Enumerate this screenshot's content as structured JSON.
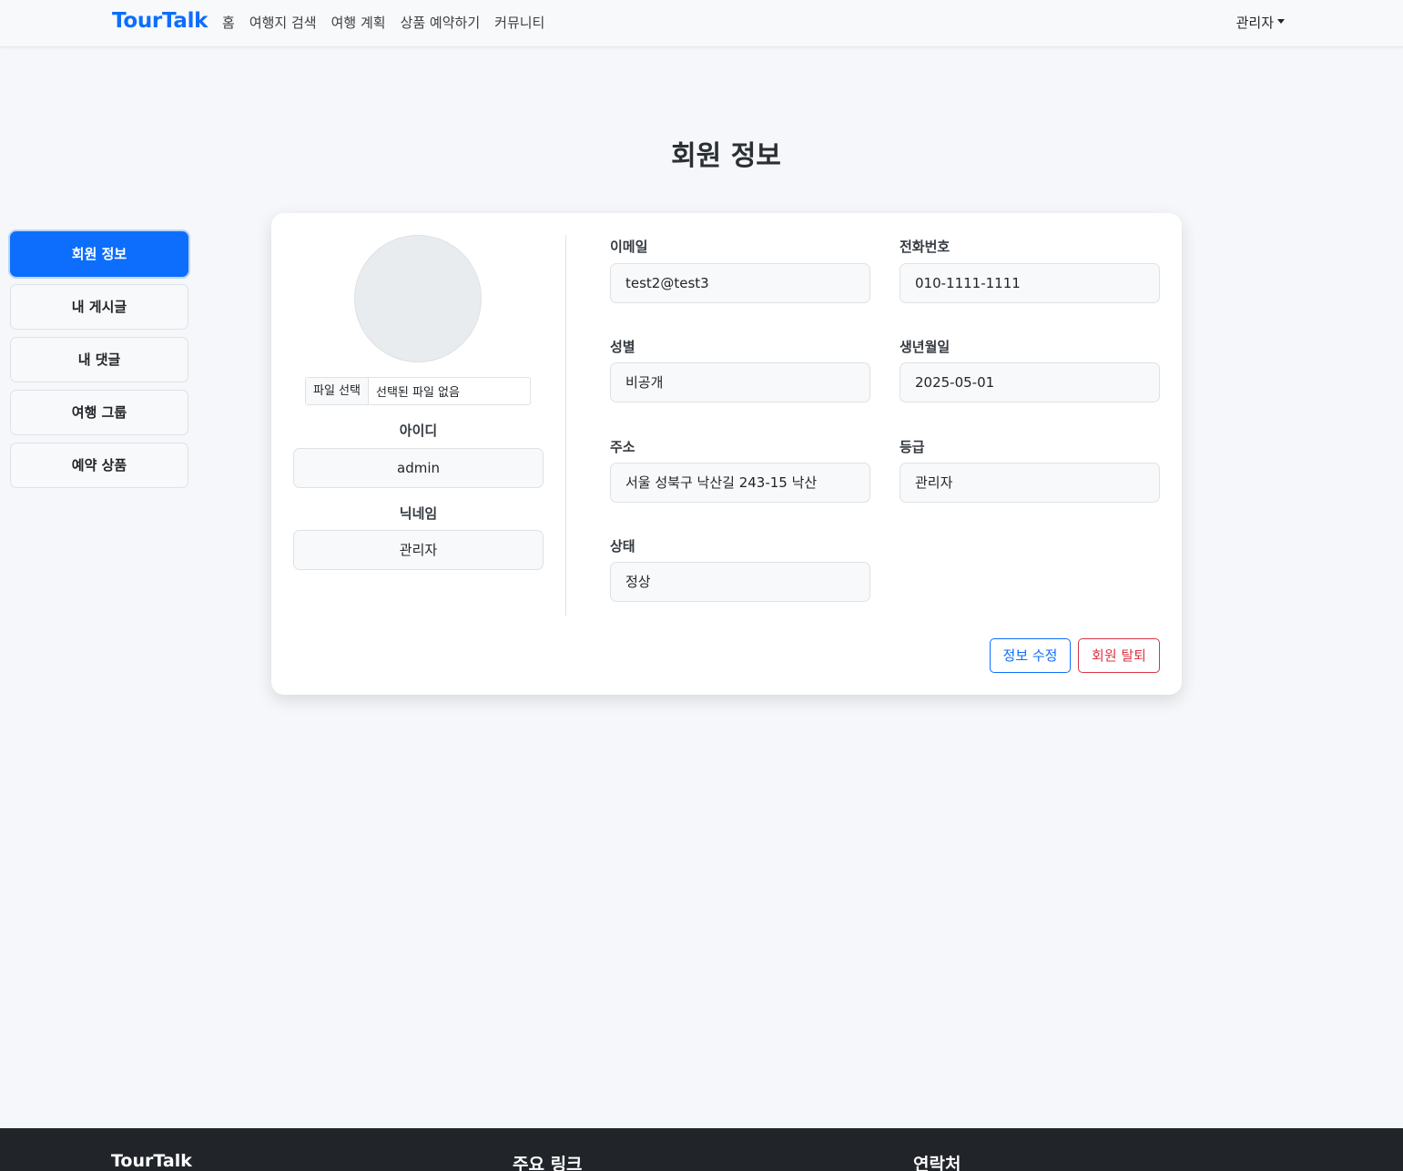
{
  "navbar": {
    "brand": "TourTalk",
    "links": [
      "홈",
      "여행지 검색",
      "여행 계획",
      "상품 예약하기",
      "커뮤니티"
    ],
    "user": "관리자"
  },
  "page": {
    "title": "회원 정보"
  },
  "sidebar": {
    "items": [
      "회원 정보",
      "내 게시글",
      "내 댓글",
      "여행 그룹",
      "예약 상품"
    ],
    "active_index": 0
  },
  "profile": {
    "file_button": "파일 선택",
    "file_status": "선택된 파일 없음",
    "id_label": "아이디",
    "id_value": "admin",
    "nickname_label": "닉네임",
    "nickname_value": "관리자"
  },
  "fields": {
    "email": {
      "label": "이메일",
      "value": "test2@test3"
    },
    "phone": {
      "label": "전화번호",
      "value": "010-1111-1111"
    },
    "gender": {
      "label": "성별",
      "value": "비공개"
    },
    "birth": {
      "label": "생년월일",
      "value": "2025-05-01"
    },
    "address": {
      "label": "주소",
      "value": "서울 성북구 낙산길 243-15 낙산"
    },
    "grade": {
      "label": "등급",
      "value": "관리자"
    },
    "status": {
      "label": "상태",
      "value": "정상"
    }
  },
  "actions": {
    "edit": "정보 수정",
    "withdraw": "회원 탈퇴"
  },
  "footer": {
    "col1": "TourTalk",
    "col2": "주요 링크",
    "col3": "연락처"
  },
  "colors": {
    "primary": "#0d6efd",
    "danger": "#dc3545",
    "footer_bg": "#212529",
    "page_bg": "#f5f7fa"
  }
}
